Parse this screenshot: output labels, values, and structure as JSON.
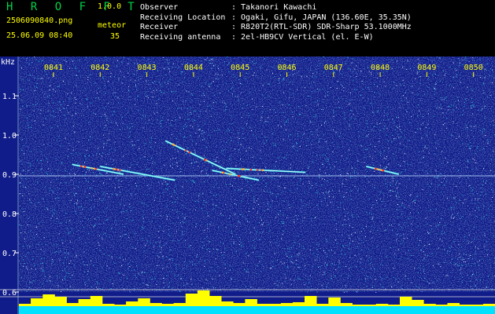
{
  "header": {
    "app_title": "H R O F F T",
    "version": "1.0.0",
    "filename": "2506090840.png",
    "datetime": "25.06.09 08:40",
    "meteor_label": "meteor",
    "meteor_count": "35",
    "info": [
      {
        "key": "Observer",
        "value": ": Takanori Kawachi"
      },
      {
        "key": "Receiving Location",
        "value": ": Ogaki, Gifu, JAPAN (136.60E, 35.35N)"
      },
      {
        "key": "Receiver",
        "value": ": R820T2(RTL-SDR) SDR-Sharp 53.1000MHz"
      },
      {
        "key": "Receiving antenna",
        "value": ": 2el-HB9CV Vertical (el. E-W)"
      }
    ]
  },
  "chart_data": {
    "type": "heatmap",
    "title": "",
    "ylabel": "kHz",
    "x_ticks": [
      "0841",
      "0842",
      "0843",
      "0844",
      "0845",
      "0846",
      "0847",
      "0848",
      "0849",
      "0850"
    ],
    "y_ticks": [
      "1.1",
      "1.0",
      "0.9",
      "0.8",
      "0.7",
      "0.6"
    ],
    "ylim": [
      0.6,
      1.2
    ],
    "colors": {
      "background": "#101c8a",
      "noise_cyan": "#2ad0e0",
      "noise_white": "#dde8ff",
      "axis_text": "#ffff00",
      "signal_red": "#ff3030",
      "level_bar": "#ffff00",
      "floor_bar": "#00e0ff"
    },
    "carrier_khz": 0.9,
    "meteor_traces": [
      {
        "t_start": "0841.4",
        "t_end": "0842.5",
        "khz_start": 0.925,
        "khz_end": 0.9
      },
      {
        "t_start": "0842.0",
        "t_end": "0843.6",
        "khz_start": 0.92,
        "khz_end": 0.885
      },
      {
        "t_start": "0843.4",
        "t_end": "0844.9",
        "khz_start": 0.985,
        "khz_end": 0.9
      },
      {
        "t_start": "0844.4",
        "t_end": "0845.4",
        "khz_start": 0.91,
        "khz_end": 0.885
      },
      {
        "t_start": "0844.7",
        "t_end": "0846.4",
        "khz_start": 0.915,
        "khz_end": 0.905
      },
      {
        "t_start": "0847.7",
        "t_end": "0848.4",
        "khz_start": 0.92,
        "khz_end": 0.9
      }
    ],
    "level_profile": [
      3,
      10,
      15,
      12,
      4,
      9,
      13,
      3,
      2,
      6,
      10,
      4,
      3,
      4,
      16,
      20,
      13,
      6,
      4,
      9,
      3,
      3,
      4,
      5,
      13,
      3,
      11,
      4,
      2,
      2,
      3,
      2,
      12,
      8,
      3,
      2,
      4,
      2,
      2,
      3
    ]
  }
}
